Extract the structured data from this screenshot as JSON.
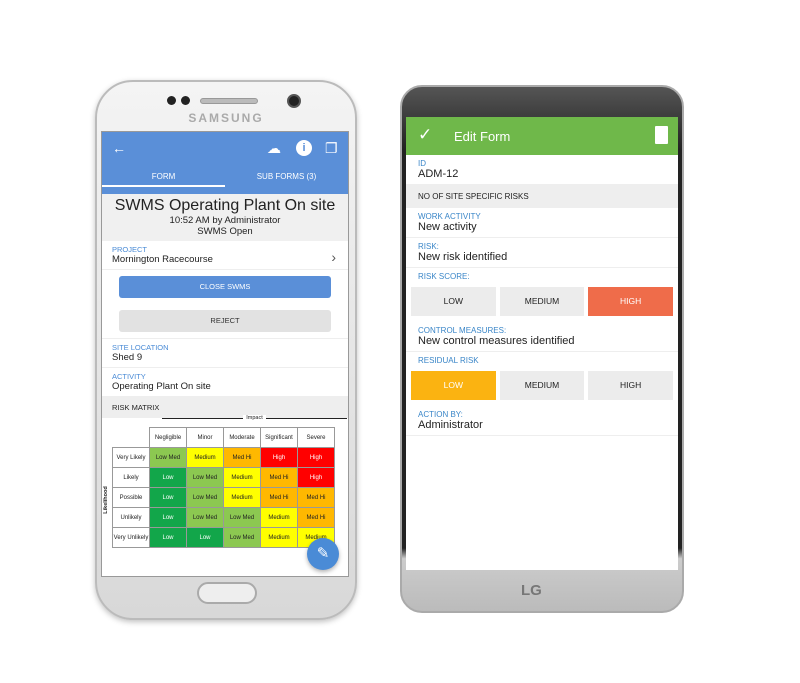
{
  "left_phone": {
    "brand": "SAMSUNG",
    "tabs": [
      "FORM",
      "SUB FORMS (3)"
    ],
    "title": "SWMS Operating Plant On site",
    "meta": "10:52 AM by Administrator",
    "status": "SWMS Open",
    "project_label": "PROJECT",
    "project": "Mornington Racecourse",
    "close_btn": "CLOSE SWMS",
    "reject_btn": "REJECT",
    "site_label": "SITE LOCATION",
    "site": "Shed 9",
    "activity_label": "ACTIVITY",
    "activity": "Operating Plant On site",
    "matrix_title": "RISK MATRIX",
    "matrix": {
      "x_axis": "Impact",
      "y_axis": "Likelihood",
      "columns": [
        "Negligible",
        "Minor",
        "Moderate",
        "Significant",
        "Severe"
      ],
      "rows": [
        {
          "label": "Very Likely",
          "cells": [
            "Low Med",
            "Medium",
            "Med Hi",
            "High",
            "High"
          ]
        },
        {
          "label": "Likely",
          "cells": [
            "Low",
            "Low Med",
            "Medium",
            "Med Hi",
            "High"
          ]
        },
        {
          "label": "Possible",
          "cells": [
            "Low",
            "Low Med",
            "Medium",
            "Med Hi",
            "Med Hi"
          ]
        },
        {
          "label": "Unlikely",
          "cells": [
            "Low",
            "Low Med",
            "Low Med",
            "Medium",
            "Med Hi"
          ]
        },
        {
          "label": "Very Unlikely",
          "cells": [
            "Low",
            "Low",
            "Low Med",
            "Medium",
            "Medium"
          ]
        }
      ],
      "colors": {
        "Low": "#12a64a",
        "Low Med": "#8cc851",
        "Medium": "#ffff00",
        "Med Hi": "#ffb800",
        "High": "#ff0000"
      }
    },
    "accent": "#5a8fd8"
  },
  "right_phone": {
    "brand": "LG",
    "title": "Edit Form",
    "id_label": "ID",
    "id": "ADM-12",
    "section": "NO OF SITE SPECIFIC RISKS",
    "work_label": "WORK ACTIVITY",
    "work": "New activity",
    "risk_label": "RISK:",
    "risk": "New risk identified",
    "score_label": "RISK SCORE:",
    "score_options": [
      "LOW",
      "MEDIUM",
      "HIGH"
    ],
    "score_selected": "HIGH",
    "control_label": "CONTROL MEASURES:",
    "control": "New control measures identified",
    "residual_label": "RESIDUAL RISK",
    "residual_options": [
      "LOW",
      "MEDIUM",
      "HIGH"
    ],
    "residual_selected": "LOW",
    "action_label": "ACTION BY:",
    "action": "Administrator",
    "accent": "#6fb84a",
    "high_color": "#ef6c4a",
    "low_color": "#fbb311"
  }
}
